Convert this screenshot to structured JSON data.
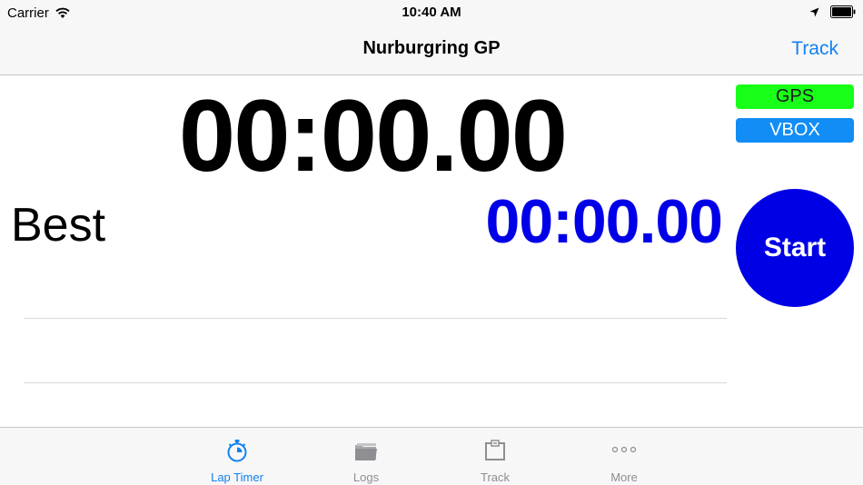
{
  "status_bar": {
    "carrier": "Carrier",
    "time": "10:40 AM",
    "icons": [
      "wifi-icon",
      "location-icon",
      "battery-icon"
    ]
  },
  "nav": {
    "title": "Nurburgring GP",
    "right_button": "Track"
  },
  "timer": {
    "current": "00:00.00",
    "best_label": "Best",
    "best_time": "00:00.00"
  },
  "badges": {
    "gps": "GPS",
    "vbox": "VBOX"
  },
  "start_button": "Start",
  "tabs": [
    {
      "label": "Lap Timer",
      "icon": "stopwatch-icon",
      "active": true
    },
    {
      "label": "Logs",
      "icon": "folder-icon",
      "active": false
    },
    {
      "label": "Track",
      "icon": "track-icon",
      "active": false
    },
    {
      "label": "More",
      "icon": "more-dots-icon",
      "active": false
    }
  ],
  "colors": {
    "accent": "#1281f2",
    "gps_badge": "#18ff18",
    "vbox_badge": "#118df5",
    "start_button": "#0000e5",
    "best_time": "#0000e8",
    "inactive_tab": "#8e8e93"
  }
}
